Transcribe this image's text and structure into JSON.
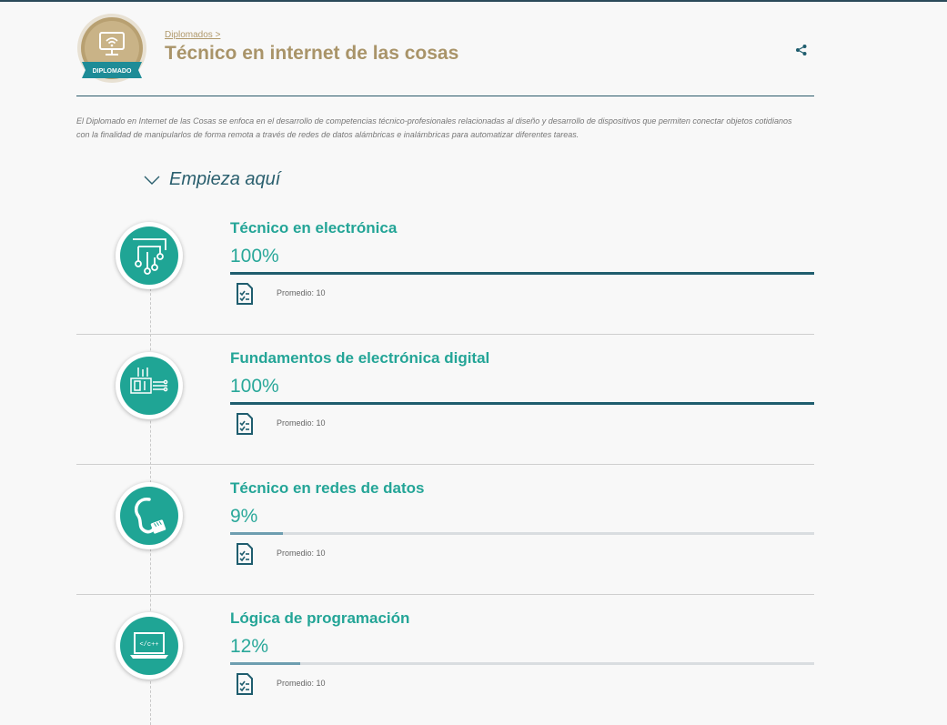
{
  "header": {
    "badge_text": "DIPLOMADO",
    "breadcrumb": "Diplomados >",
    "title": "Técnico en internet de las cosas"
  },
  "description": "El Diplomado en Internet de las Cosas se enfoca en el desarrollo de competencias técnico-profesionales relacionadas al diseño y desarrollo de dispositivos que permiten conectar objetos cotidianos con la finalidad de manipularlos de forma remota a través de redes de datos alámbricas e inalámbricas para automatizar diferentes tareas.",
  "start_here": "Empieza aquí",
  "courses": [
    {
      "title": "Técnico en electrónica",
      "percent_label": "100%",
      "progress": 1.0,
      "average": "Promedio: 10",
      "icon": "circuit-board-icon"
    },
    {
      "title": "Fundamentos de electrónica digital",
      "percent_label": "100%",
      "progress": 1.0,
      "average": "Promedio: 10",
      "icon": "digital-display-icon"
    },
    {
      "title": "Técnico en redes de datos",
      "percent_label": "9%",
      "progress": 0.09,
      "average": "Promedio: 10",
      "icon": "network-cable-icon"
    },
    {
      "title": "Lógica de programación",
      "percent_label": "12%",
      "progress": 0.12,
      "average": "Promedio: 10",
      "icon": "laptop-code-icon",
      "icon_text": "</c++"
    }
  ],
  "colors": {
    "accent": "#24a597",
    "gold": "#a99469",
    "dark": "#1f5d6e"
  }
}
